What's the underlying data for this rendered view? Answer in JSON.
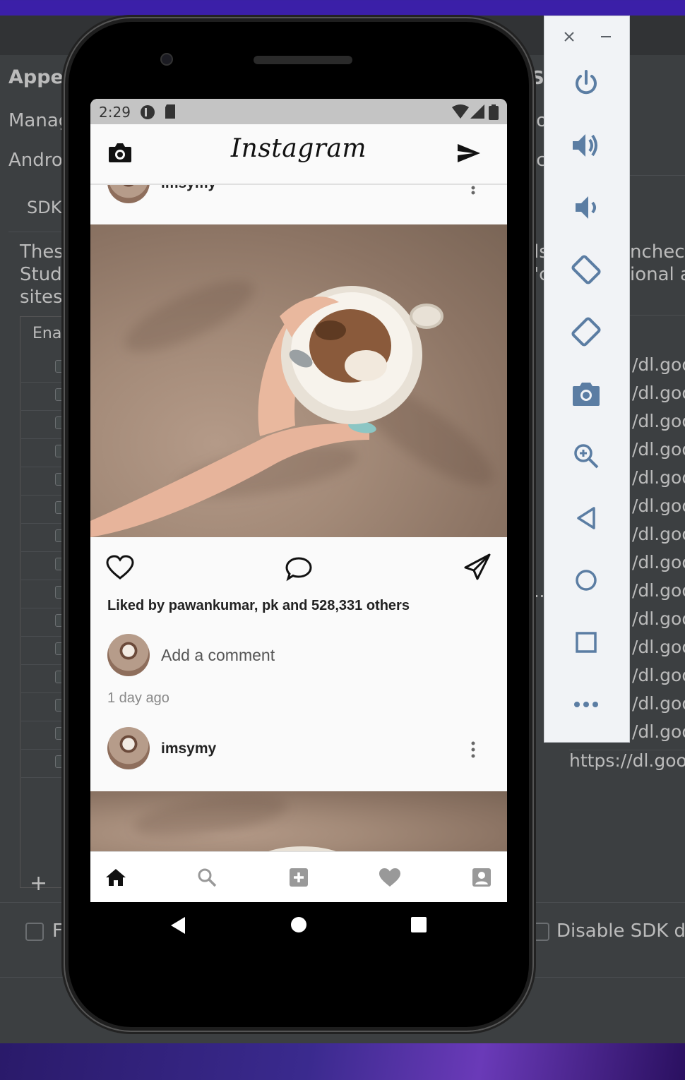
{
  "ide": {
    "heading": "Appea",
    "left_labels": [
      "Manag",
      "Androi",
      "SDK"
    ],
    "desc_lines": [
      "Thes",
      "Studi",
      "sites"
    ],
    "table_header": "Enal",
    "right_labels": {
      "top1": "SI",
      "top2": "lo",
      "top3": "ic"
    },
    "right_desc": [
      "ls",
      "'c",
      "ncheck",
      "ional a"
    ],
    "url_fragment": "/dl.goo",
    "url_rows": 14,
    "last_url": "https://dl.goo",
    "ellipsis": "..",
    "add_symbol": "+",
    "bottom_left_check_label": "F",
    "bottom_right_check_label": "Disable SDK di"
  },
  "status_bar": {
    "time": "2:29"
  },
  "app": {
    "logo": "Instagram",
    "top_post_username": "imsymy",
    "likes_text": "Liked by pawankumar, pk and 528,331 others",
    "comment_placeholder": "Add a comment",
    "timestamp": "1 day ago",
    "next_post_username": "imsymy"
  },
  "icons": {
    "appbar_left": "camera-icon",
    "appbar_right": "send-icon",
    "actions": [
      "heart-icon",
      "comment-icon",
      "share-icon"
    ],
    "bottom_nav": [
      "home-icon",
      "search-icon",
      "add-box-icon",
      "favorite-icon",
      "profile-icon"
    ],
    "panel": [
      "close-icon",
      "minimize-icon",
      "power-icon",
      "volume-up-icon",
      "volume-down-icon",
      "rotate-left-icon",
      "rotate-right-icon",
      "screenshot-icon",
      "zoom-icon",
      "back-icon",
      "home-icon",
      "overview-icon",
      "more-icon"
    ]
  }
}
